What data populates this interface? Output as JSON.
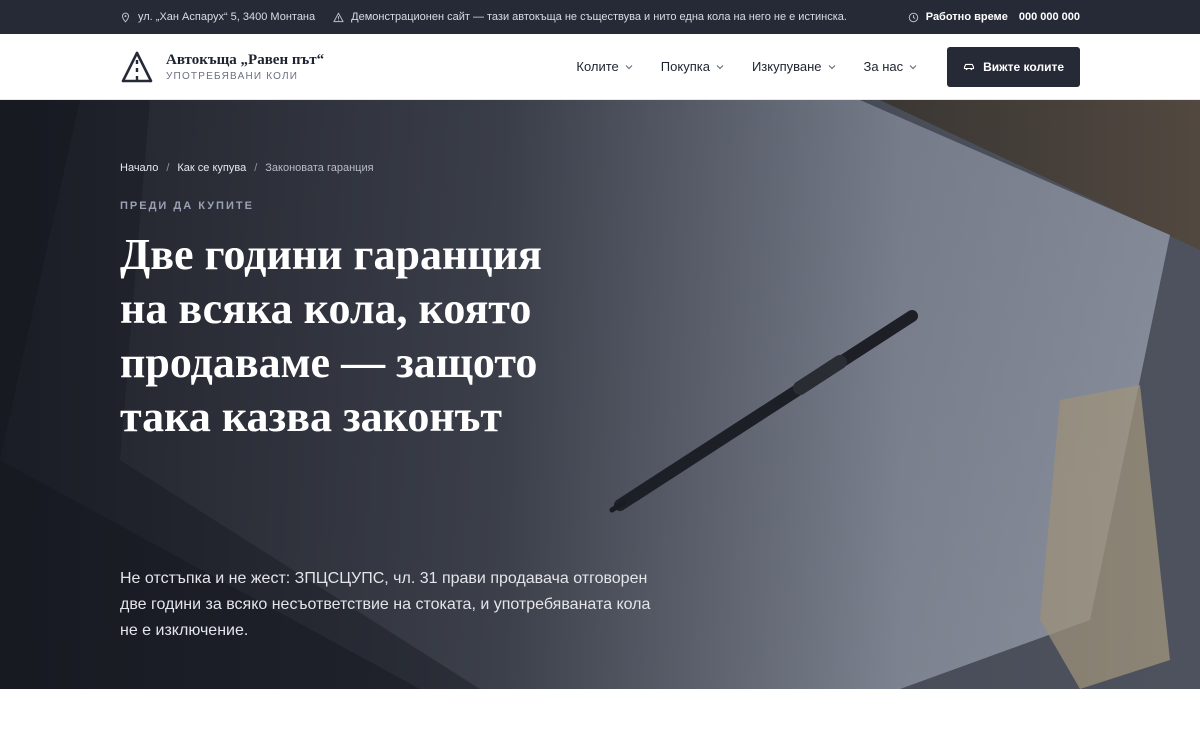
{
  "topbar": {
    "address": "ул. „Хан Аспарух“ 5, 3400 Монтана",
    "notice": "Демонстрационен сайт — тази автокъща не съществува и нито една кола на него не е истинска.",
    "hours_label": "Работно време",
    "phone": "000 000 000",
    "icons": [
      "location-pin-icon",
      "warning-icon",
      "clock-icon"
    ]
  },
  "header": {
    "brand_name": "Автокъща „Равен път“",
    "brand_tagline": "УПОТРЕБЯВАНИ КОЛИ",
    "nav": [
      {
        "label": "Колите"
      },
      {
        "label": "Покупка"
      },
      {
        "label": "Изкупуване"
      },
      {
        "label": "За нас"
      }
    ],
    "cta_label": "Вижте колите"
  },
  "hero": {
    "breadcrumb": [
      "Начало",
      "Как се купува",
      "Законовата гаранция"
    ],
    "eyebrow": "ПРЕДИ ДА КУПИТЕ",
    "title": "Две години гаранция на всяка кола, която продаваме — защото така казва законът",
    "lead": "Не отстъпка и не жест: ЗПЦСЦУПС, чл. 31 прави продавача отговорен две години за всяко несъответствие на стоката, и употребяваната кола не е изключение."
  },
  "colors": {
    "dark": "#262a36",
    "white": "#ffffff",
    "eyebrow": "#9aa1b4"
  }
}
